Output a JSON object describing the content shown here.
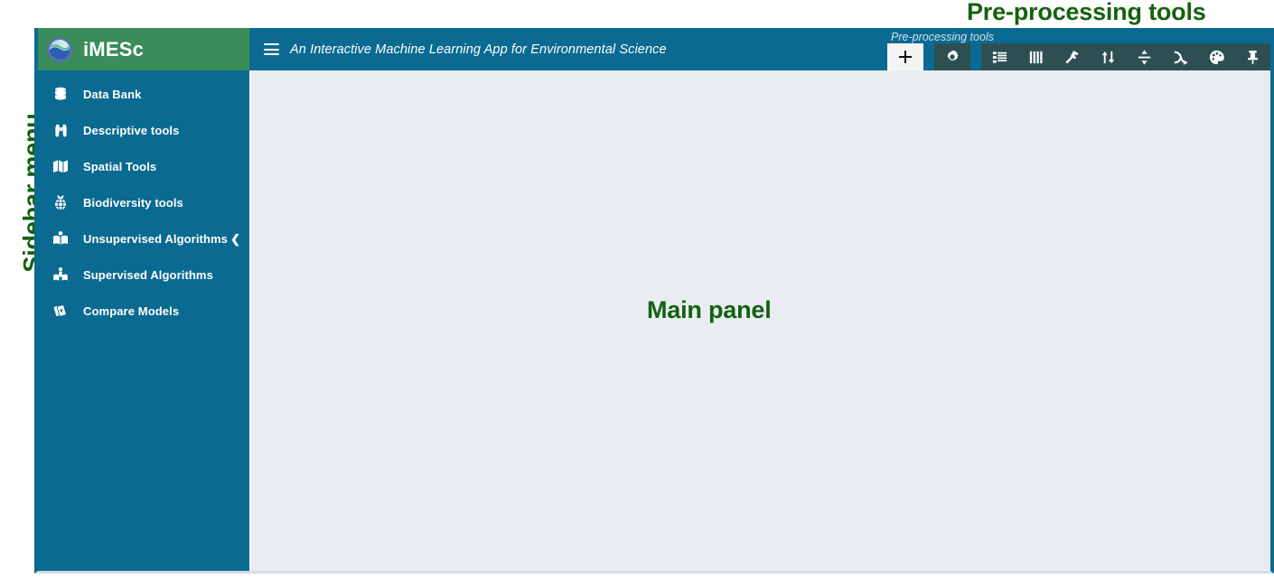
{
  "annotations": {
    "preprocessing": "Pre-processing tools",
    "sidebar": "Sidebar menu",
    "main_panel": "Main panel",
    "color": "#15610f"
  },
  "colors": {
    "brand_green": "#3a8c5b",
    "teal": "#0b6a91",
    "toolbar_dark": "#2d4f52",
    "panel_bg": "#e9edf2",
    "active_btn": "#f4f4f4",
    "text_white": "#ffffff"
  },
  "brand": {
    "title": "iMESc",
    "logo_icon": "globe-logo-icon"
  },
  "header": {
    "menu_icon": "hamburger-icon",
    "subtitle": "An Interactive Machine Learning App for Environmental Science"
  },
  "toolbar": {
    "label": "Pre-processing tools",
    "buttons": [
      {
        "name": "add-button",
        "icon": "plus-icon",
        "state": "active"
      },
      {
        "name": "settings-button",
        "icon": "gear-icon",
        "state": "dark"
      },
      {
        "name": "datalist-button",
        "icon": "list-icon",
        "state": "group"
      },
      {
        "name": "columns-button",
        "icon": "columns-icon",
        "state": "group"
      },
      {
        "name": "transform-button",
        "icon": "hammer-icon",
        "state": "group"
      },
      {
        "name": "shuffle-button",
        "icon": "swap-arrows-icon",
        "state": "group"
      },
      {
        "name": "split-button",
        "icon": "divide-icon",
        "state": "group"
      },
      {
        "name": "merge-button",
        "icon": "merge-arrow-icon",
        "state": "group"
      },
      {
        "name": "palette-button",
        "icon": "palette-icon",
        "state": "group"
      },
      {
        "name": "pin-button",
        "icon": "pushpin-icon",
        "state": "group"
      }
    ]
  },
  "sidebar": {
    "items": [
      {
        "label": "Data Bank",
        "icon": "database-icon",
        "expandable": false,
        "arrow": ""
      },
      {
        "label": "Descriptive tools",
        "icon": "binoculars-icon",
        "expandable": false,
        "arrow": ""
      },
      {
        "label": "Spatial Tools",
        "icon": "map-icon",
        "expandable": false,
        "arrow": ""
      },
      {
        "label": "Biodiversity tools",
        "icon": "biodiversity-icon",
        "expandable": false,
        "arrow": ""
      },
      {
        "label": "Unsupervised Algorithms",
        "icon": "book-open-icon",
        "expandable": true,
        "arrow": "❮"
      },
      {
        "label": "Supervised Algorithms",
        "icon": "person-book-icon",
        "expandable": false,
        "arrow": ""
      },
      {
        "label": "Compare Models",
        "icon": "cards-icon",
        "expandable": false,
        "arrow": ""
      }
    ]
  },
  "main": {
    "content": ""
  }
}
